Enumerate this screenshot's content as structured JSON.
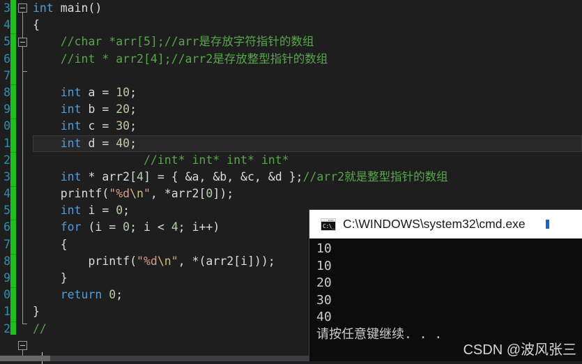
{
  "editor": {
    "language": "c",
    "theme_background": "#1E1E1E",
    "change_bar_color": "#1FBF1F",
    "lines": [
      {
        "num": "3",
        "indent": 0,
        "current": false,
        "tokens": [
          {
            "t": "int",
            "c": "kw"
          },
          {
            "t": " main()",
            "c": "pun"
          }
        ]
      },
      {
        "num": "4",
        "indent": 0,
        "current": false,
        "tokens": [
          {
            "t": "{",
            "c": "brc"
          }
        ]
      },
      {
        "num": "5",
        "indent": 0,
        "current": false,
        "tokens": [
          {
            "t": "    //char *arr[5];//arr是存放字符指针的数组",
            "c": "cm"
          }
        ]
      },
      {
        "num": "6",
        "indent": 0,
        "current": false,
        "tokens": [
          {
            "t": "    //int * arr2[4];//arr2是存放整型指针的数组",
            "c": "cm"
          }
        ]
      },
      {
        "num": "7",
        "indent": 0,
        "current": false,
        "tokens": []
      },
      {
        "num": "8",
        "indent": 0,
        "current": false,
        "tokens": [
          {
            "t": "    ",
            "c": "pun"
          },
          {
            "t": "int",
            "c": "kw"
          },
          {
            "t": " a = ",
            "c": "pun"
          },
          {
            "t": "10",
            "c": "num"
          },
          {
            "t": ";",
            "c": "pun"
          }
        ]
      },
      {
        "num": "9",
        "indent": 0,
        "current": false,
        "tokens": [
          {
            "t": "    ",
            "c": "pun"
          },
          {
            "t": "int",
            "c": "kw"
          },
          {
            "t": " b = ",
            "c": "pun"
          },
          {
            "t": "20",
            "c": "num"
          },
          {
            "t": ";",
            "c": "pun"
          }
        ]
      },
      {
        "num": "0",
        "indent": 0,
        "current": false,
        "tokens": [
          {
            "t": "    ",
            "c": "pun"
          },
          {
            "t": "int",
            "c": "kw"
          },
          {
            "t": " c = ",
            "c": "pun"
          },
          {
            "t": "30",
            "c": "num"
          },
          {
            "t": ";",
            "c": "pun"
          }
        ]
      },
      {
        "num": "1",
        "indent": 0,
        "current": true,
        "tokens": [
          {
            "t": "    ",
            "c": "pun"
          },
          {
            "t": "int",
            "c": "kw"
          },
          {
            "t": " d = ",
            "c": "pun"
          },
          {
            "t": "40",
            "c": "num"
          },
          {
            "t": ";",
            "c": "pun"
          }
        ]
      },
      {
        "num": "2",
        "indent": 0,
        "current": false,
        "tokens": [
          {
            "t": "                //int* int* int* int*",
            "c": "cm"
          }
        ]
      },
      {
        "num": "3",
        "indent": 0,
        "current": false,
        "tokens": [
          {
            "t": "    ",
            "c": "pun"
          },
          {
            "t": "int",
            "c": "kw"
          },
          {
            "t": " * arr2[",
            "c": "pun"
          },
          {
            "t": "4",
            "c": "num"
          },
          {
            "t": "] = { &a, &b, &c, &d };",
            "c": "pun"
          },
          {
            "t": "//arr2就是整型指针的数组",
            "c": "cm"
          }
        ]
      },
      {
        "num": "4",
        "indent": 0,
        "current": false,
        "tokens": [
          {
            "t": "    ",
            "c": "pun"
          },
          {
            "t": "printf",
            "c": "fn"
          },
          {
            "t": "(",
            "c": "pun"
          },
          {
            "t": "\"%d",
            "c": "str"
          },
          {
            "t": "\\n",
            "c": "esc"
          },
          {
            "t": "\"",
            "c": "str"
          },
          {
            "t": ", *arr2[",
            "c": "pun"
          },
          {
            "t": "0",
            "c": "num"
          },
          {
            "t": "]);",
            "c": "pun"
          }
        ]
      },
      {
        "num": "5",
        "indent": 0,
        "current": false,
        "tokens": [
          {
            "t": "    ",
            "c": "pun"
          },
          {
            "t": "int",
            "c": "kw"
          },
          {
            "t": " i = ",
            "c": "pun"
          },
          {
            "t": "0",
            "c": "num"
          },
          {
            "t": ";",
            "c": "pun"
          }
        ]
      },
      {
        "num": "6",
        "indent": 0,
        "current": false,
        "tokens": [
          {
            "t": "    ",
            "c": "pun"
          },
          {
            "t": "for",
            "c": "kw"
          },
          {
            "t": " (i = ",
            "c": "pun"
          },
          {
            "t": "0",
            "c": "num"
          },
          {
            "t": "; i < ",
            "c": "pun"
          },
          {
            "t": "4",
            "c": "num"
          },
          {
            "t": "; i++)",
            "c": "pun"
          }
        ]
      },
      {
        "num": "7",
        "indent": 0,
        "current": false,
        "tokens": [
          {
            "t": "    {",
            "c": "brc"
          }
        ]
      },
      {
        "num": "8",
        "indent": 0,
        "current": false,
        "tokens": [
          {
            "t": "        ",
            "c": "pun"
          },
          {
            "t": "printf",
            "c": "fn"
          },
          {
            "t": "(",
            "c": "pun"
          },
          {
            "t": "\"%d",
            "c": "str"
          },
          {
            "t": "\\n",
            "c": "esc"
          },
          {
            "t": "\"",
            "c": "str"
          },
          {
            "t": ", *(arr2[i]));",
            "c": "pun"
          }
        ]
      },
      {
        "num": "9",
        "indent": 0,
        "current": false,
        "tokens": [
          {
            "t": "    }",
            "c": "brc"
          }
        ]
      },
      {
        "num": "0",
        "indent": 0,
        "current": false,
        "tokens": [
          {
            "t": "    ",
            "c": "pun"
          },
          {
            "t": "return",
            "c": "kw"
          },
          {
            "t": " ",
            "c": "pun"
          },
          {
            "t": "0",
            "c": "num"
          },
          {
            "t": ";",
            "c": "pun"
          }
        ]
      },
      {
        "num": "1",
        "indent": 0,
        "current": false,
        "tokens": [
          {
            "t": "}",
            "c": "brc"
          }
        ]
      },
      {
        "num": "2",
        "indent": 0,
        "current": false,
        "tokens": [
          {
            "t": "//",
            "c": "cm"
          }
        ]
      }
    ]
  },
  "console": {
    "title": "C:\\WINDOWS\\system32\\cmd.exe",
    "icon": "cmd-console-icon",
    "icon_prompt": "C:\\_",
    "output": [
      "10",
      "10",
      "20",
      "30",
      "40",
      "请按任意键继续. . ."
    ],
    "watermark": "CSDN @波风张三"
  }
}
